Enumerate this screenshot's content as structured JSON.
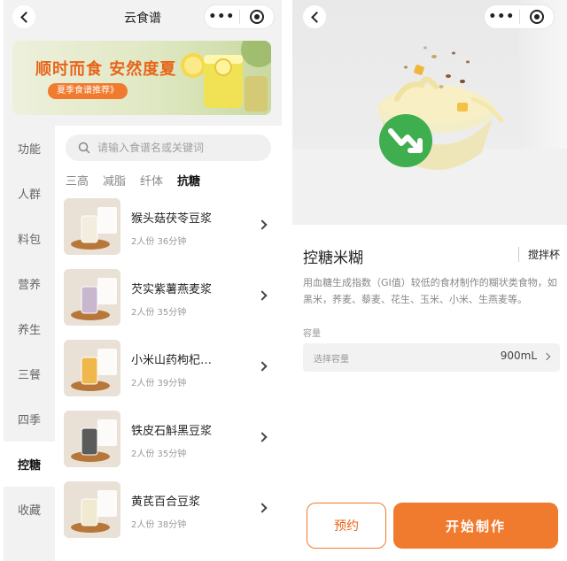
{
  "left": {
    "nav": {
      "title": "云食谱"
    },
    "banner": {
      "title": "顺时而食 安然度夏",
      "tag": "夏季食谱推荐》"
    },
    "sidebar": {
      "items": [
        {
          "label": "功能"
        },
        {
          "label": "人群"
        },
        {
          "label": "料包"
        },
        {
          "label": "营养"
        },
        {
          "label": "养生"
        },
        {
          "label": "三餐"
        },
        {
          "label": "四季"
        },
        {
          "label": "控糖",
          "active": true
        },
        {
          "label": "收藏"
        }
      ]
    },
    "search": {
      "placeholder": "请输入食谱名或关键词"
    },
    "categories": [
      {
        "label": "三高"
      },
      {
        "label": "减脂"
      },
      {
        "label": "纤体"
      },
      {
        "label": "抗糖",
        "active": true
      }
    ],
    "recipes": [
      {
        "name": "猴头菇茯苓豆浆",
        "meta": "2人份 36分钟",
        "drink_color": "#f3ede0"
      },
      {
        "name": "芡实紫薯燕麦浆",
        "meta": "2人份 35分钟",
        "drink_color": "#c9b6cf"
      },
      {
        "name": "小米山药枸杞…",
        "meta": "2人份 39分钟",
        "drink_color": "#f0b84a"
      },
      {
        "name": "铁皮石斛黑豆浆",
        "meta": "2人份 35分钟",
        "drink_color": "#5b5b5b"
      },
      {
        "name": "黄芪百合豆浆",
        "meta": "2人份 38分钟",
        "drink_color": "#f1ead2"
      }
    ]
  },
  "right": {
    "product": {
      "title": "控糖米糊",
      "cup": "搅拌杯",
      "description": "用血糖生成指数（GI值）较低的食材制作的糊状类食物，如黑米，荞麦、藜麦、花生、玉米、小米、生燕麦等。"
    },
    "capacity": {
      "label": "容量",
      "placeholder": "选择容量",
      "value": "900mL"
    },
    "buttons": {
      "reserve": "预约",
      "start": "开始制作"
    }
  },
  "colors": {
    "accent": "#f07a2d",
    "accent_dark": "#e8641b",
    "badge_green": "#3fae4e"
  },
  "icons": [
    "back-chevron-icon",
    "more-dots-icon",
    "target-circle-icon",
    "search-icon",
    "chevron-right-icon",
    "low-gi-down-arrow-icon"
  ]
}
